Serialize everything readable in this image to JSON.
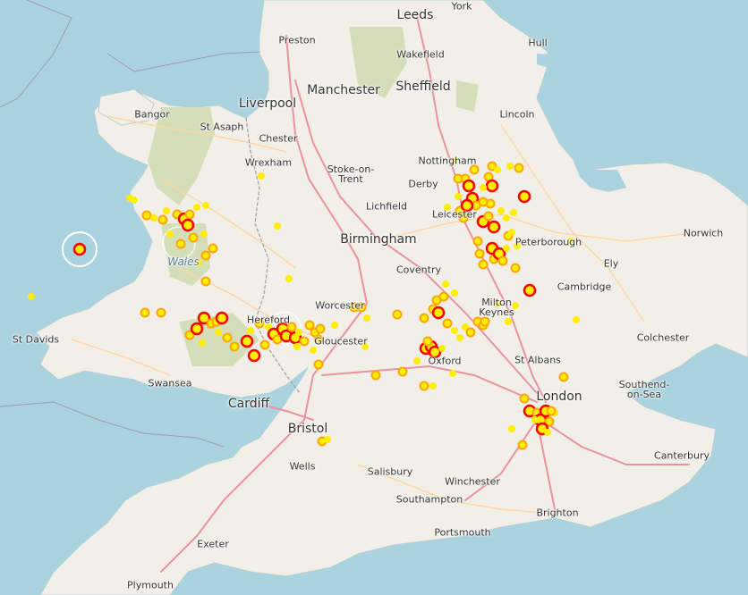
{
  "map": {
    "colors": {
      "sea": "#aad3df",
      "land": "#f2efe9",
      "park": "#c8d7a4",
      "motorway": "#e892a2",
      "primary": "#fcd6a4",
      "border": "#9e9cab",
      "low": "#ffee00",
      "medium": "#ffa500",
      "high": "#ff0000"
    },
    "places": [
      {
        "id": "leeds",
        "name": "Leeds",
        "size": "large"
      },
      {
        "id": "york",
        "name": "York",
        "size": "small"
      },
      {
        "id": "preston",
        "name": "Preston",
        "size": "small"
      },
      {
        "id": "hull",
        "name": "Hull",
        "size": "small"
      },
      {
        "id": "wakefield",
        "name": "Wakefield",
        "size": "small"
      },
      {
        "id": "manchester",
        "name": "Manchester",
        "size": "large"
      },
      {
        "id": "sheffield",
        "name": "Sheffield",
        "size": "large"
      },
      {
        "id": "liverpool",
        "name": "Liverpool",
        "size": "large"
      },
      {
        "id": "bangor",
        "name": "Bangor",
        "size": "small"
      },
      {
        "id": "st-asaph",
        "name": "St Asaph",
        "size": "small"
      },
      {
        "id": "chester",
        "name": "Chester",
        "size": "small"
      },
      {
        "id": "lincoln",
        "name": "Lincoln",
        "size": "small"
      },
      {
        "id": "wrexham",
        "name": "Wrexham",
        "size": "small"
      },
      {
        "id": "nottingham",
        "name": "Nottingham",
        "size": "small"
      },
      {
        "id": "stoke-on-trent",
        "name": "Stoke-on-Trent",
        "size": "small"
      },
      {
        "id": "derby",
        "name": "Derby",
        "size": "small"
      },
      {
        "id": "lichfield",
        "name": "Lichfield",
        "size": "small"
      },
      {
        "id": "leicester",
        "name": "Leicester",
        "size": "small"
      },
      {
        "id": "norwich",
        "name": "Norwich",
        "size": "small"
      },
      {
        "id": "birmingham",
        "name": "Birmingham",
        "size": "large"
      },
      {
        "id": "peterborough",
        "name": "Peterborough",
        "size": "small"
      },
      {
        "id": "ely",
        "name": "Ely",
        "size": "small"
      },
      {
        "id": "coventry",
        "name": "Coventry",
        "size": "small"
      },
      {
        "id": "cambridge",
        "name": "Cambridge",
        "size": "small"
      },
      {
        "id": "worcester",
        "name": "Worcester",
        "size": "small"
      },
      {
        "id": "milton-keynes",
        "name": "Milton Keynes",
        "size": "small"
      },
      {
        "id": "hereford",
        "name": "Hereford",
        "size": "small"
      },
      {
        "id": "gloucester",
        "name": "Gloucester",
        "size": "small"
      },
      {
        "id": "st-davids",
        "name": "St Davids",
        "size": "small"
      },
      {
        "id": "colchester",
        "name": "Colchester",
        "size": "small"
      },
      {
        "id": "oxford",
        "name": "Oxford",
        "size": "small"
      },
      {
        "id": "st-albans",
        "name": "St Albans",
        "size": "small"
      },
      {
        "id": "swansea",
        "name": "Swansea",
        "size": "small"
      },
      {
        "id": "southend-on-sea",
        "name": "Southend-on-Sea",
        "size": "small"
      },
      {
        "id": "london",
        "name": "London",
        "size": "large"
      },
      {
        "id": "cardiff",
        "name": "Cardiff",
        "size": "large"
      },
      {
        "id": "bristol",
        "name": "Bristol",
        "size": "large"
      },
      {
        "id": "canterbury",
        "name": "Canterbury",
        "size": "small"
      },
      {
        "id": "wells",
        "name": "Wells",
        "size": "small"
      },
      {
        "id": "salisbury",
        "name": "Salisbury",
        "size": "small"
      },
      {
        "id": "winchester",
        "name": "Winchester",
        "size": "small"
      },
      {
        "id": "southampton",
        "name": "Southampton",
        "size": "small"
      },
      {
        "id": "brighton",
        "name": "Brighton",
        "size": "small"
      },
      {
        "id": "portsmouth",
        "name": "Portsmouth",
        "size": "small"
      },
      {
        "id": "exeter",
        "name": "Exeter",
        "size": "small"
      },
      {
        "id": "plymouth",
        "name": "Plymouth",
        "size": "small"
      },
      {
        "id": "wales",
        "name": "Wales",
        "size": "water"
      }
    ],
    "markers": [
      {
        "level": "high",
        "count": 1
      },
      {
        "level": "medium",
        "count": 1
      },
      {
        "level": "low",
        "count": 1
      }
    ]
  }
}
